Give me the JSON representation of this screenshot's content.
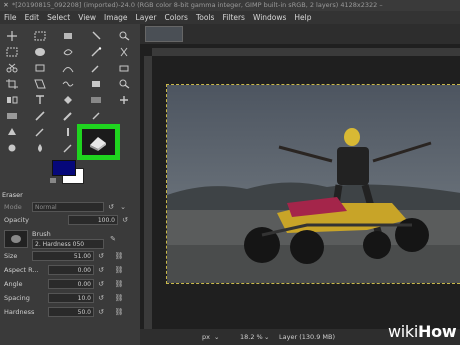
{
  "titlebar": {
    "text": "*[20190815_092208] (imported)-24.0 (RGB color 8-bit gamma integer, GIMP built-in sRGB, 2 layers) 4128x2322 –"
  },
  "menu": [
    "File",
    "Edit",
    "Select",
    "View",
    "Image",
    "Layer",
    "Colors",
    "Tools",
    "Filters",
    "Windows",
    "Help"
  ],
  "tool_options": {
    "title": "Eraser",
    "mode_label": "Mode",
    "mode_value": "Normal",
    "opacity_label": "Opacity",
    "opacity_value": "100.0",
    "brush_label": "Brush",
    "brush_value": "2. Hardness 050",
    "size_label": "Size",
    "size_value": "51.00",
    "aspect_label": "Aspect R...",
    "aspect_value": "0.00",
    "angle_label": "Angle",
    "angle_value": "0.00",
    "spacing_label": "Spacing",
    "spacing_value": "10.0",
    "hardness_label": "Hardness",
    "hardness_value": "50.0"
  },
  "colors": {
    "foreground": "#06087a",
    "background": "#ffffff",
    "highlight": "#1fd41f"
  },
  "status": {
    "unit": "px",
    "zoom": "18.2 %",
    "layer_info": "Layer (130.9 MB)"
  },
  "watermark": {
    "wiki": "wiki",
    "how": "How"
  }
}
